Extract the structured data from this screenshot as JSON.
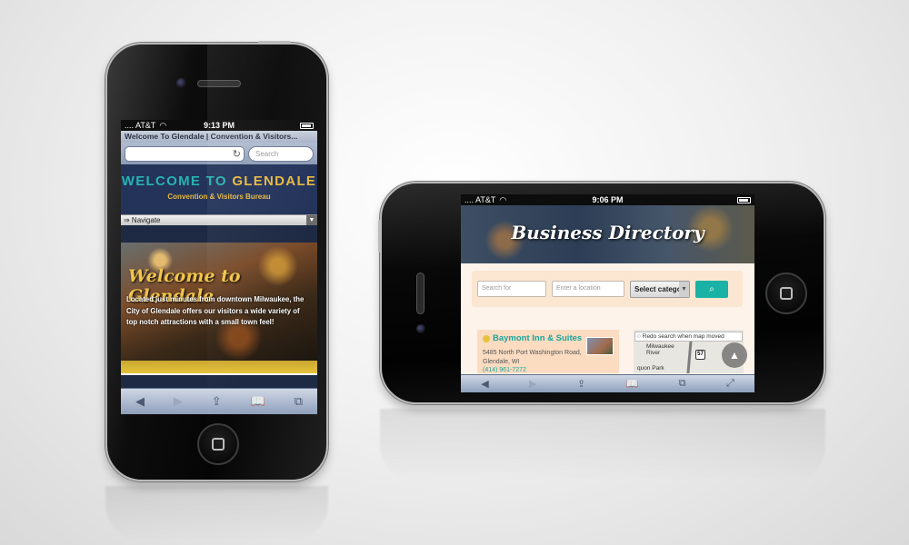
{
  "portrait": {
    "status": {
      "carrier": ".... AT&T",
      "time": "9:13 PM"
    },
    "browser": {
      "page_title": "Welcome To Glendale | Convention & Visitors...",
      "search_placeholder": "Search"
    },
    "site": {
      "logo_part1": "WELCOME TO",
      "logo_part2": "GLENDALE",
      "subtitle": "Convention & Visitors Bureau",
      "nav_label": "⇒ Navigate",
      "hero_title": "Welcome to Glendale",
      "hero_text": "Located just minutes from downtown Milwaukee, the City of Glendale offers our visitors a wide variety of top notch attractions with a small town feel!"
    },
    "toolbar": [
      "back",
      "forward",
      "share",
      "bookmarks",
      "tabs"
    ]
  },
  "landscape": {
    "status": {
      "carrier": ".... AT&T",
      "time": "9:06 PM"
    },
    "site": {
      "banner_title": "Business Directory",
      "search_placeholder": "Search for",
      "location_placeholder": "Enter a location",
      "category_select": "Select catego",
      "listing": {
        "name": "Baymont Inn & Suites",
        "address": "5485 North Port Washington Road, Glendale, WI",
        "phone": "(414) 961-7272"
      },
      "map": {
        "redo_label": "Redo search when map moved",
        "river_label": "Milwaukee River",
        "park_label": "quon Park",
        "highway": "57"
      }
    },
    "toolbar": [
      "back",
      "forward",
      "share",
      "bookmarks",
      "tabs",
      "fullscreen"
    ]
  },
  "colors": {
    "teal": "#27b3b0",
    "gold": "#e7b940",
    "navy": "#23335a",
    "button_teal": "#1ab2a4"
  }
}
